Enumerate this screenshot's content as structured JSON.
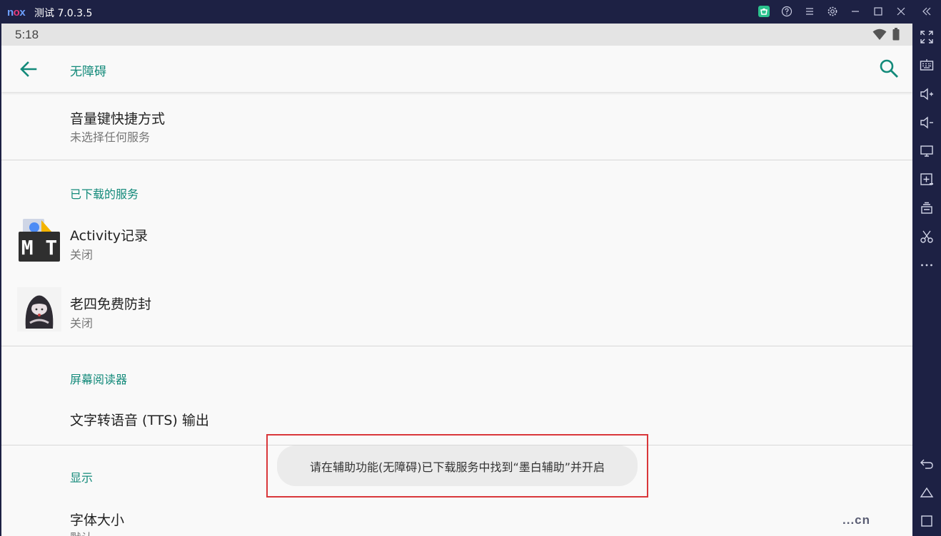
{
  "window": {
    "logo": {
      "n": "n",
      "o": "o",
      "x": "x"
    },
    "title": "测试 7.0.3.5",
    "icons": [
      "shop-icon",
      "help-icon",
      "menu-icon",
      "settings-icon",
      "minimize-icon",
      "maximize-icon",
      "close-icon",
      "collapse-icon"
    ]
  },
  "status": {
    "time": "5:18",
    "icons": [
      "wifi-icon",
      "battery-icon"
    ]
  },
  "appbar": {
    "title": "无障碍"
  },
  "settings": {
    "volume_shortcut": {
      "title": "音量键快捷方式",
      "subtitle": "未选择任何服务"
    },
    "downloaded_section": "已下载的服务",
    "services": [
      {
        "title": "Activity记录",
        "subtitle": "关闭",
        "icon": "mt-manager-icon",
        "icon_text": "M T"
      },
      {
        "title": "老四免费防封",
        "subtitle": "关闭",
        "icon": "avatar-icon"
      }
    ],
    "screen_reader_section": "屏幕阅读器",
    "tts": {
      "title": "文字转语音 (TTS) 输出"
    },
    "display_section": "显示",
    "font_size": {
      "title": "字体大小",
      "subtitle": "默认"
    }
  },
  "toast": {
    "message": "请在辅助功能(无障碍)已下载服务中找到“墨白辅助”并开启"
  },
  "sidebar_icons": [
    "fullscreen-icon",
    "keyboard-icon",
    "volume-up-icon",
    "volume-down-icon",
    "screen-icon",
    "add-apk-icon",
    "multi-instance-icon",
    "screenshot-icon",
    "more-icon",
    "back-nav-icon",
    "home-nav-icon",
    "recents-nav-icon"
  ],
  "watermark": "...cn",
  "colors": {
    "accent": "#138a7a",
    "titlebar": "#1d2144",
    "toast_frame": "#d9373a"
  }
}
